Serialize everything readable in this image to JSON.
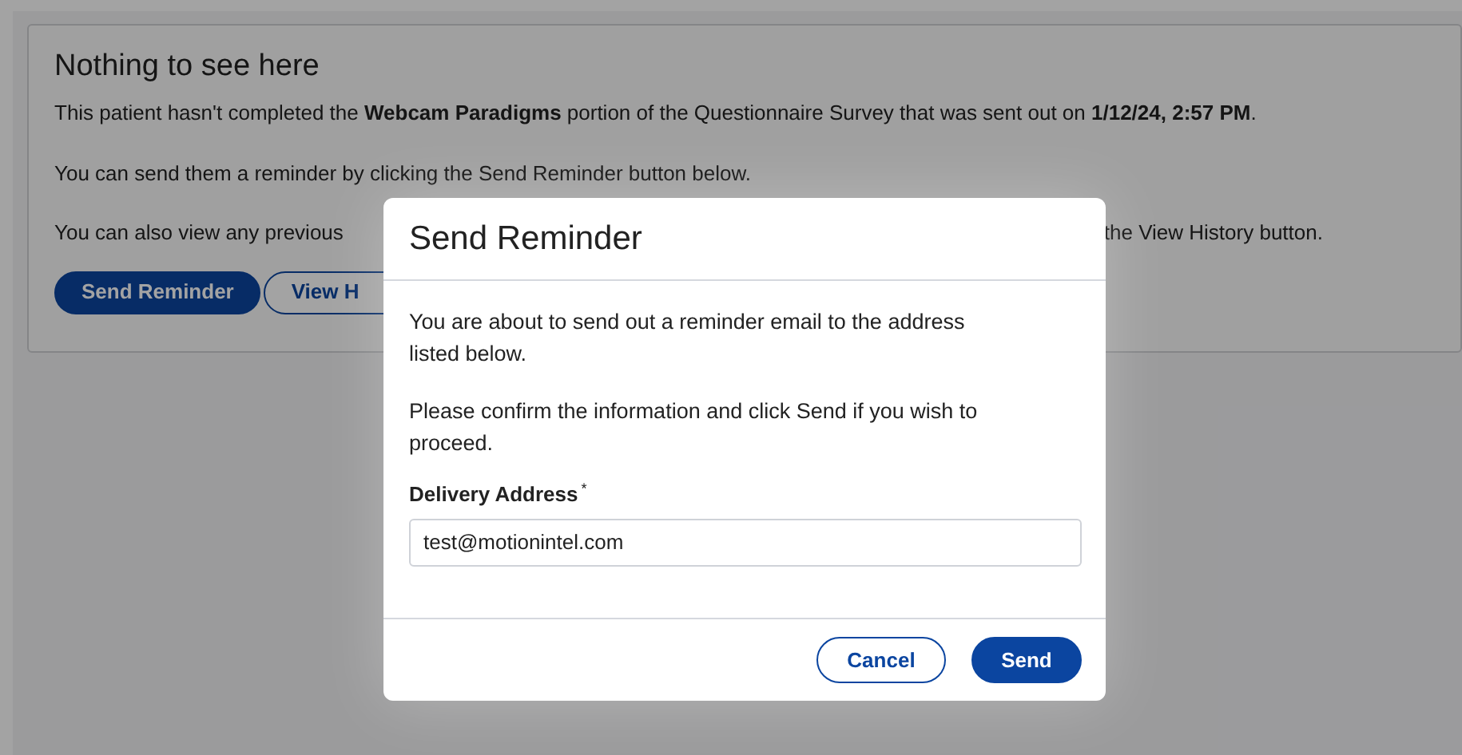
{
  "panel": {
    "title": "Nothing to see here",
    "paragraphs": [
      "This patient hasn't completed the **Webcam Paradigms** portion of the Questionnaire Survey that was sent out on **1/12/24, 2:57 PM**.",
      "You can send them a reminder by clicking the Send Reminder button below."
    ],
    "partial_line": {
      "start": "You can also view any previous",
      "end": "the View History button."
    },
    "buttons": [
      {
        "label": "Send Reminder",
        "kind": "primary"
      },
      {
        "label": "View H",
        "kind": "outline"
      }
    ]
  },
  "modal": {
    "title": "Send Reminder",
    "paragraphs": [
      "You are about to send out a reminder email to the address listed below.",
      "Please confirm the information and click Send if you wish to proceed."
    ],
    "field": {
      "label": "Delivery Address",
      "required_mark": "*",
      "value": "test@motionintel.com"
    },
    "buttons": [
      {
        "label": "Cancel",
        "kind": "outline"
      },
      {
        "label": "Send",
        "kind": "primary"
      }
    ]
  }
}
